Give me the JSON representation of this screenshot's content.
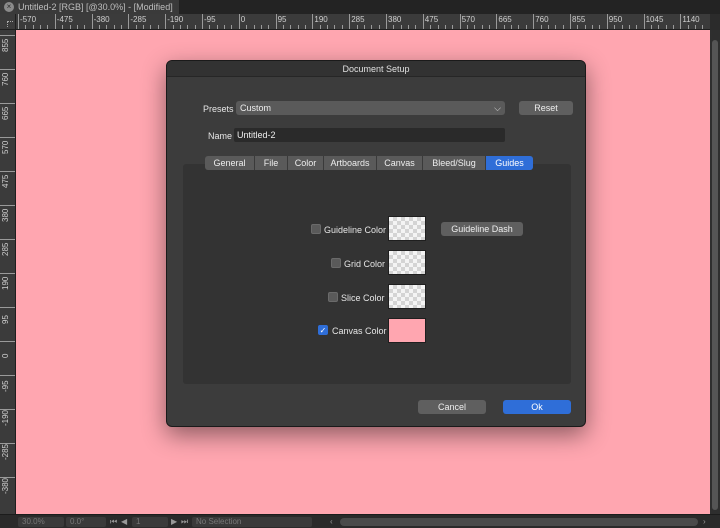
{
  "document_tab": {
    "title": "Untitled-2 [RGB] [@30.0%] - [Modified]",
    "close_glyph": "×"
  },
  "ruler": {
    "top_labels": [
      "-570",
      "-475",
      "-380",
      "-285",
      "-190",
      "-95",
      "0",
      "95",
      "190",
      "285",
      "380",
      "475",
      "570",
      "665",
      "760",
      "855",
      "950",
      "1045",
      "1140",
      "1235"
    ],
    "left_labels": [
      "855",
      "760",
      "665",
      "570",
      "475",
      "380",
      "285",
      "190",
      "95",
      "0",
      "-95",
      "-190",
      "-285",
      "-380"
    ]
  },
  "canvas": {
    "background_color": "#ffa6b0"
  },
  "dialog": {
    "title": "Document Setup",
    "presets_label": "Presets",
    "presets_value": "Custom",
    "reset_label": "Reset",
    "name_label": "Name",
    "name_value": "Untitled-2",
    "tabs": [
      {
        "label": "General"
      },
      {
        "label": "File"
      },
      {
        "label": "Color"
      },
      {
        "label": "Artboards"
      },
      {
        "label": "Canvas"
      },
      {
        "label": "Bleed/Slug"
      },
      {
        "label": "Guides",
        "active": true
      }
    ],
    "guides": {
      "guideline_color_label": "Guideline Color",
      "guideline_color_checked": false,
      "guideline_dash_label": "Guideline Dash",
      "grid_color_label": "Grid Color",
      "grid_color_checked": false,
      "slice_color_label": "Slice Color",
      "slice_color_checked": false,
      "canvas_color_label": "Canvas Color",
      "canvas_color_checked": true,
      "canvas_color_value": "#ffa6b0",
      "check_glyph": "✓"
    },
    "cancel_label": "Cancel",
    "ok_label": "Ok"
  },
  "statusbar": {
    "zoom": "30.0%",
    "rotation": "0.0°",
    "page": "1",
    "selection": "No Selection"
  },
  "colors": {
    "accent": "#2f6ed8"
  }
}
